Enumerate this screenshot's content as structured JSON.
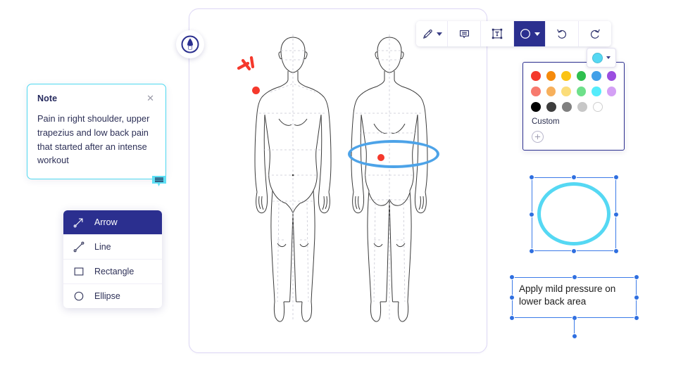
{
  "app": {
    "logo_icon": "marker-pen-circle-logo"
  },
  "toolbar": {
    "items": [
      {
        "id": "pen",
        "icon": "pen-icon",
        "label": "Draw",
        "has_dropdown": true,
        "active": false
      },
      {
        "id": "comment",
        "icon": "comment-icon",
        "label": "Comment",
        "has_dropdown": false,
        "active": false
      },
      {
        "id": "textbox",
        "icon": "text-box-icon",
        "label": "Text box",
        "has_dropdown": false,
        "active": false
      },
      {
        "id": "shape",
        "icon": "ellipse-icon",
        "label": "Shape",
        "has_dropdown": true,
        "active": true
      },
      {
        "id": "undo",
        "icon": "undo-icon",
        "label": "Undo",
        "has_dropdown": false,
        "active": false
      },
      {
        "id": "redo",
        "icon": "redo-icon",
        "label": "Redo",
        "has_dropdown": false,
        "active": false
      }
    ]
  },
  "color_picker": {
    "button_icon": "color-swatch-icon",
    "selected_color": "#55d8f3",
    "custom_label": "Custom",
    "add_custom_icon": "plus-circle-icon",
    "rows": [
      [
        "#f4392c",
        "#f58a0b",
        "#fbc314",
        "#2fbf4f",
        "#42a0e8",
        "#9b4ee0"
      ],
      [
        "#f77a6e",
        "#f7b05c",
        "#fbdd7a",
        "#6ee08a",
        "#55ecfb",
        "#d4a0f5"
      ],
      [
        "#000000",
        "#3d3d3d",
        "#808080",
        "#c7c7c7",
        "#ffffff"
      ]
    ]
  },
  "shape_menu": {
    "items": [
      {
        "label": "Arrow",
        "icon": "arrow-icon",
        "selected": true
      },
      {
        "label": "Line",
        "icon": "line-icon",
        "selected": false
      },
      {
        "label": "Rectangle",
        "icon": "rectangle-icon",
        "selected": false
      },
      {
        "label": "Ellipse",
        "icon": "ellipse-icon",
        "selected": false
      }
    ]
  },
  "note": {
    "title": "Note",
    "body": "Pain in right shoulder, upper trapezius and low back pain that started after an intense workout",
    "close_icon": "close-icon",
    "marker_icon": "note-marker-icon",
    "border_color": "#4fd9f0"
  },
  "canvas": {
    "figures": [
      {
        "id": "front-view",
        "label": "anatomical-figure-front"
      },
      {
        "id": "back-view",
        "label": "anatomical-figure-back"
      }
    ],
    "annotations": [
      {
        "id": "shoulder-pain-strokes",
        "type": "pain-strokes",
        "color": "#f5392c"
      },
      {
        "id": "shoulder-pain-dot",
        "type": "dot",
        "color": "#f5392c"
      },
      {
        "id": "lower-back-ellipse",
        "type": "ellipse",
        "color": "#4da3e8"
      },
      {
        "id": "lower-back-pain-dot",
        "type": "dot",
        "color": "#f5392c"
      }
    ]
  },
  "selected_shape": {
    "type": "ellipse",
    "stroke_color": "#55d8f3",
    "selection_color": "#2f6fe0"
  },
  "selected_textbox": {
    "text": "Apply mild pressure on lower back area",
    "selection_color": "#2f6fe0"
  }
}
